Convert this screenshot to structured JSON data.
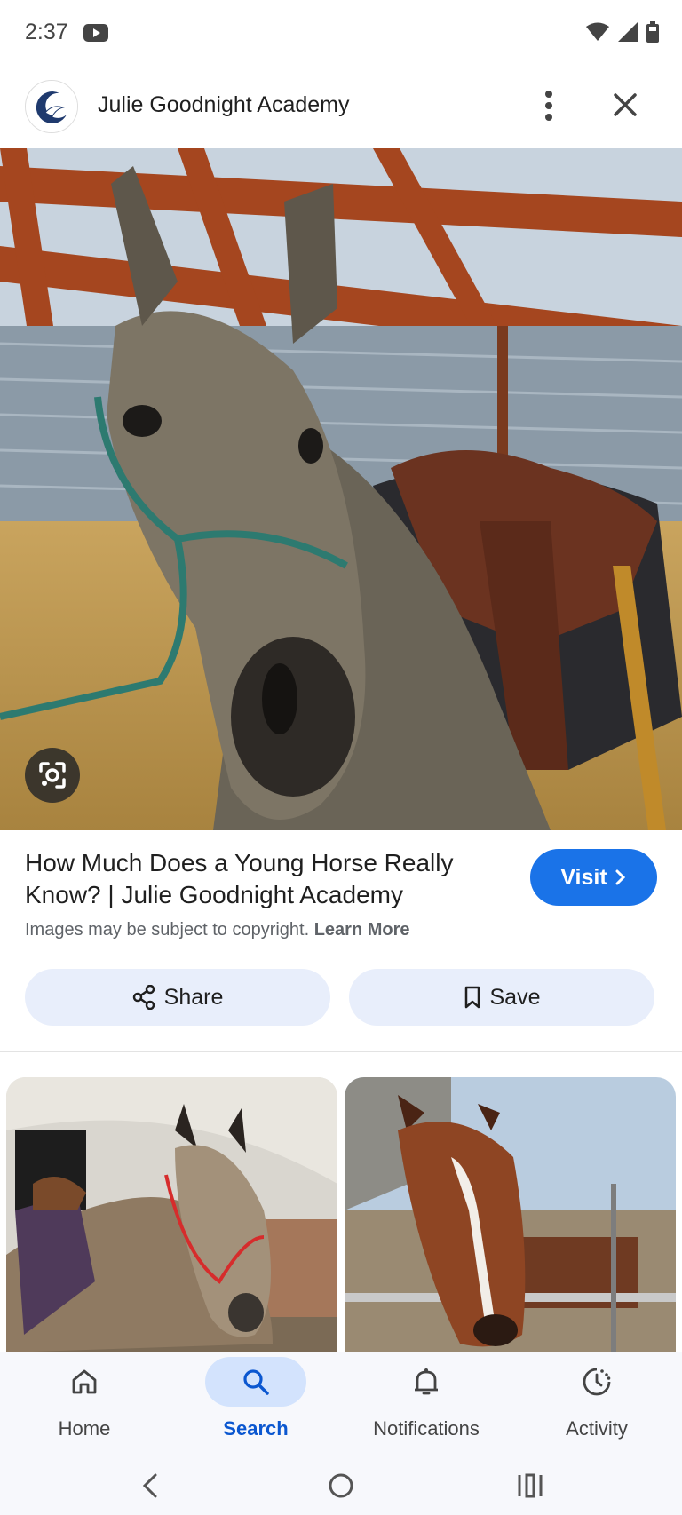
{
  "status_bar": {
    "time": "2:37"
  },
  "header": {
    "site_name": "Julie Goodnight Academy"
  },
  "result": {
    "title": "How Much Does a Young Horse Really Know? | Julie Goodnight Academy",
    "visit_label": "Visit",
    "copyright_text": "Images may be subject to copyright.",
    "learn_more_label": "Learn More"
  },
  "actions": {
    "share_label": "Share",
    "save_label": "Save"
  },
  "bottom_nav": {
    "items": [
      {
        "label": "Home",
        "icon": "home-icon",
        "selected": false
      },
      {
        "label": "Search",
        "icon": "search-icon",
        "selected": true
      },
      {
        "label": "Notifications",
        "icon": "bell-icon",
        "selected": false
      },
      {
        "label": "Activity",
        "icon": "activity-icon",
        "selected": false
      }
    ]
  },
  "colors": {
    "accent": "#1a73e8",
    "selected_nav_bg": "#d3e3fd",
    "action_button_bg": "#e8eefb"
  }
}
